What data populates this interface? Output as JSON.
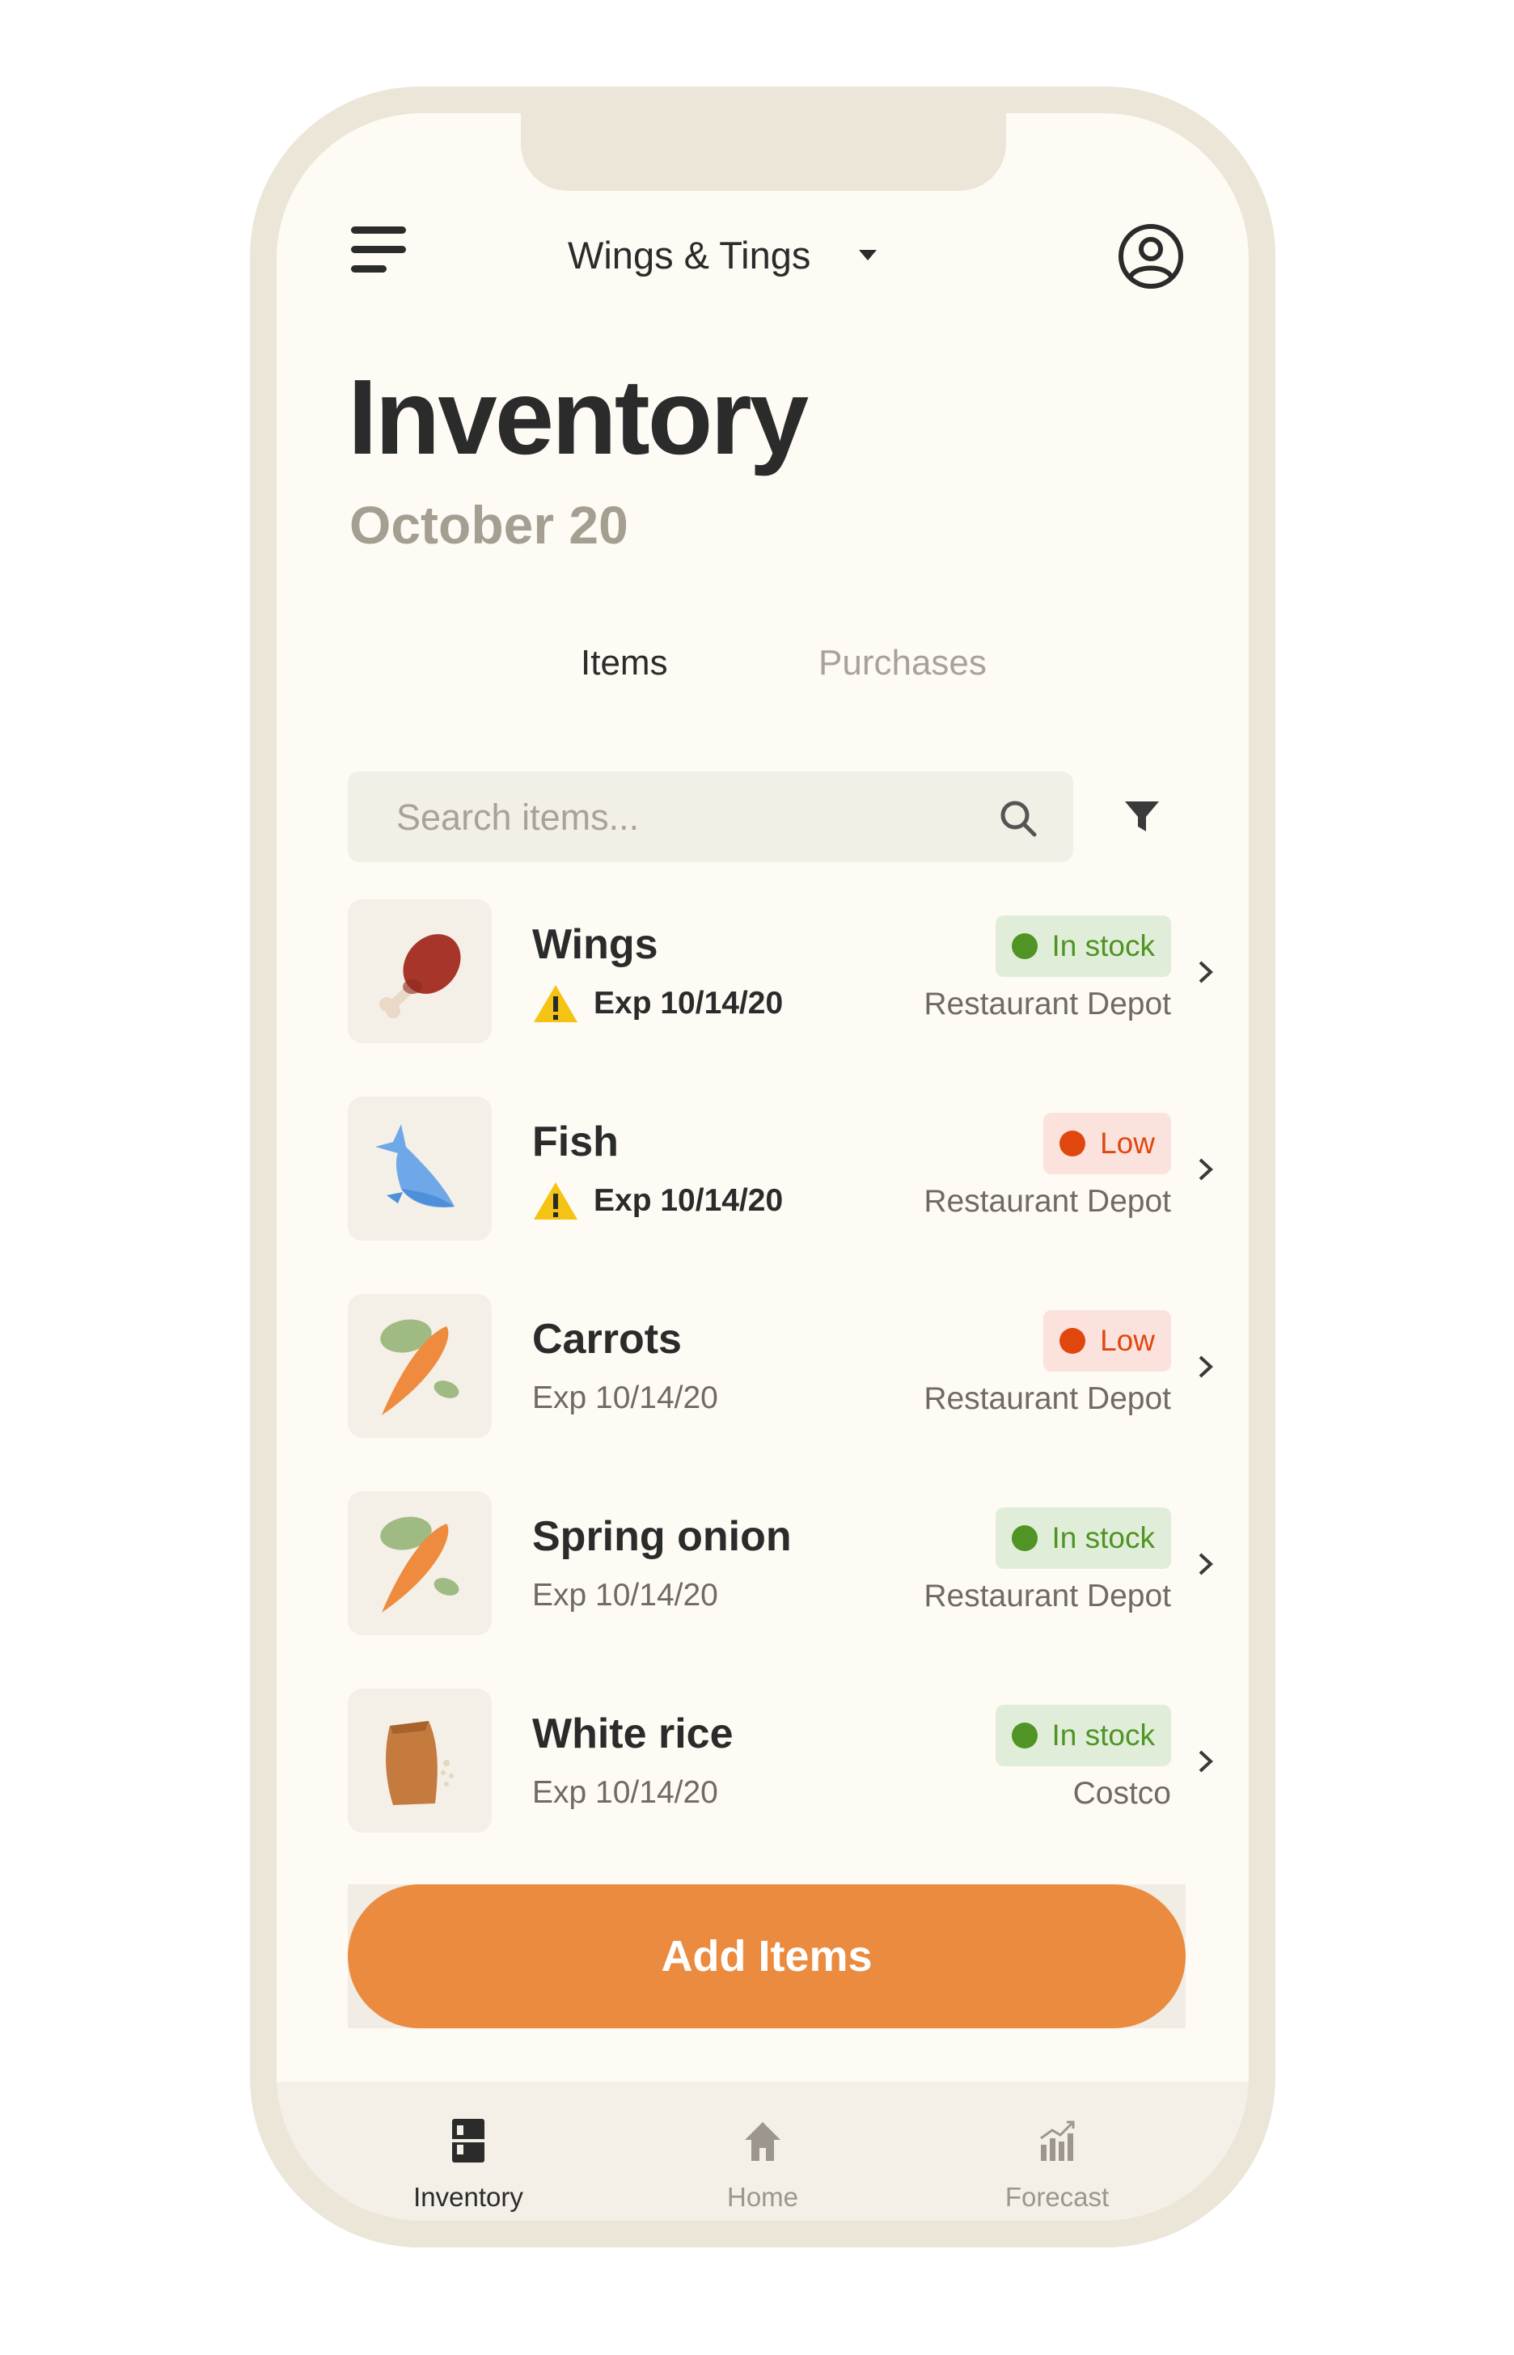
{
  "header": {
    "location_name": "Wings & Tings"
  },
  "page": {
    "title": "Inventory",
    "date": "October 20"
  },
  "tabs": [
    {
      "label": "Items",
      "active": true
    },
    {
      "label": "Purchases",
      "active": false
    }
  ],
  "search": {
    "placeholder": "Search items..."
  },
  "items": [
    {
      "name": "Wings",
      "exp": "Exp 10/14/20",
      "warning": true,
      "status": "In stock",
      "supplier": "Restaurant Depot",
      "icon": "chicken-leg-icon"
    },
    {
      "name": "Fish",
      "exp": "Exp 10/14/20",
      "warning": true,
      "status": "Low",
      "supplier": "Restaurant Depot",
      "icon": "fish-icon"
    },
    {
      "name": "Carrots",
      "exp": "Exp 10/14/20",
      "warning": false,
      "status": "Low",
      "supplier": "Restaurant Depot",
      "icon": "carrot-icon"
    },
    {
      "name": "Spring onion",
      "exp": "Exp 10/14/20",
      "warning": false,
      "status": "In stock",
      "supplier": "Restaurant Depot",
      "icon": "carrot-icon"
    },
    {
      "name": "White rice",
      "exp": "Exp 10/14/20",
      "warning": false,
      "status": "In stock",
      "supplier": "Costco",
      "icon": "rice-bag-icon"
    }
  ],
  "actions": {
    "add_label": "Add Items"
  },
  "bottom_nav": [
    {
      "label": "Inventory",
      "active": true,
      "icon": "inventory-icon"
    },
    {
      "label": "Home",
      "active": false,
      "icon": "home-icon"
    },
    {
      "label": "Forecast",
      "active": false,
      "icon": "forecast-icon"
    }
  ],
  "colors": {
    "accent": "#ea8b40",
    "in_stock": "#4f9424",
    "low": "#e0470e",
    "background": "#fdfbf4"
  }
}
